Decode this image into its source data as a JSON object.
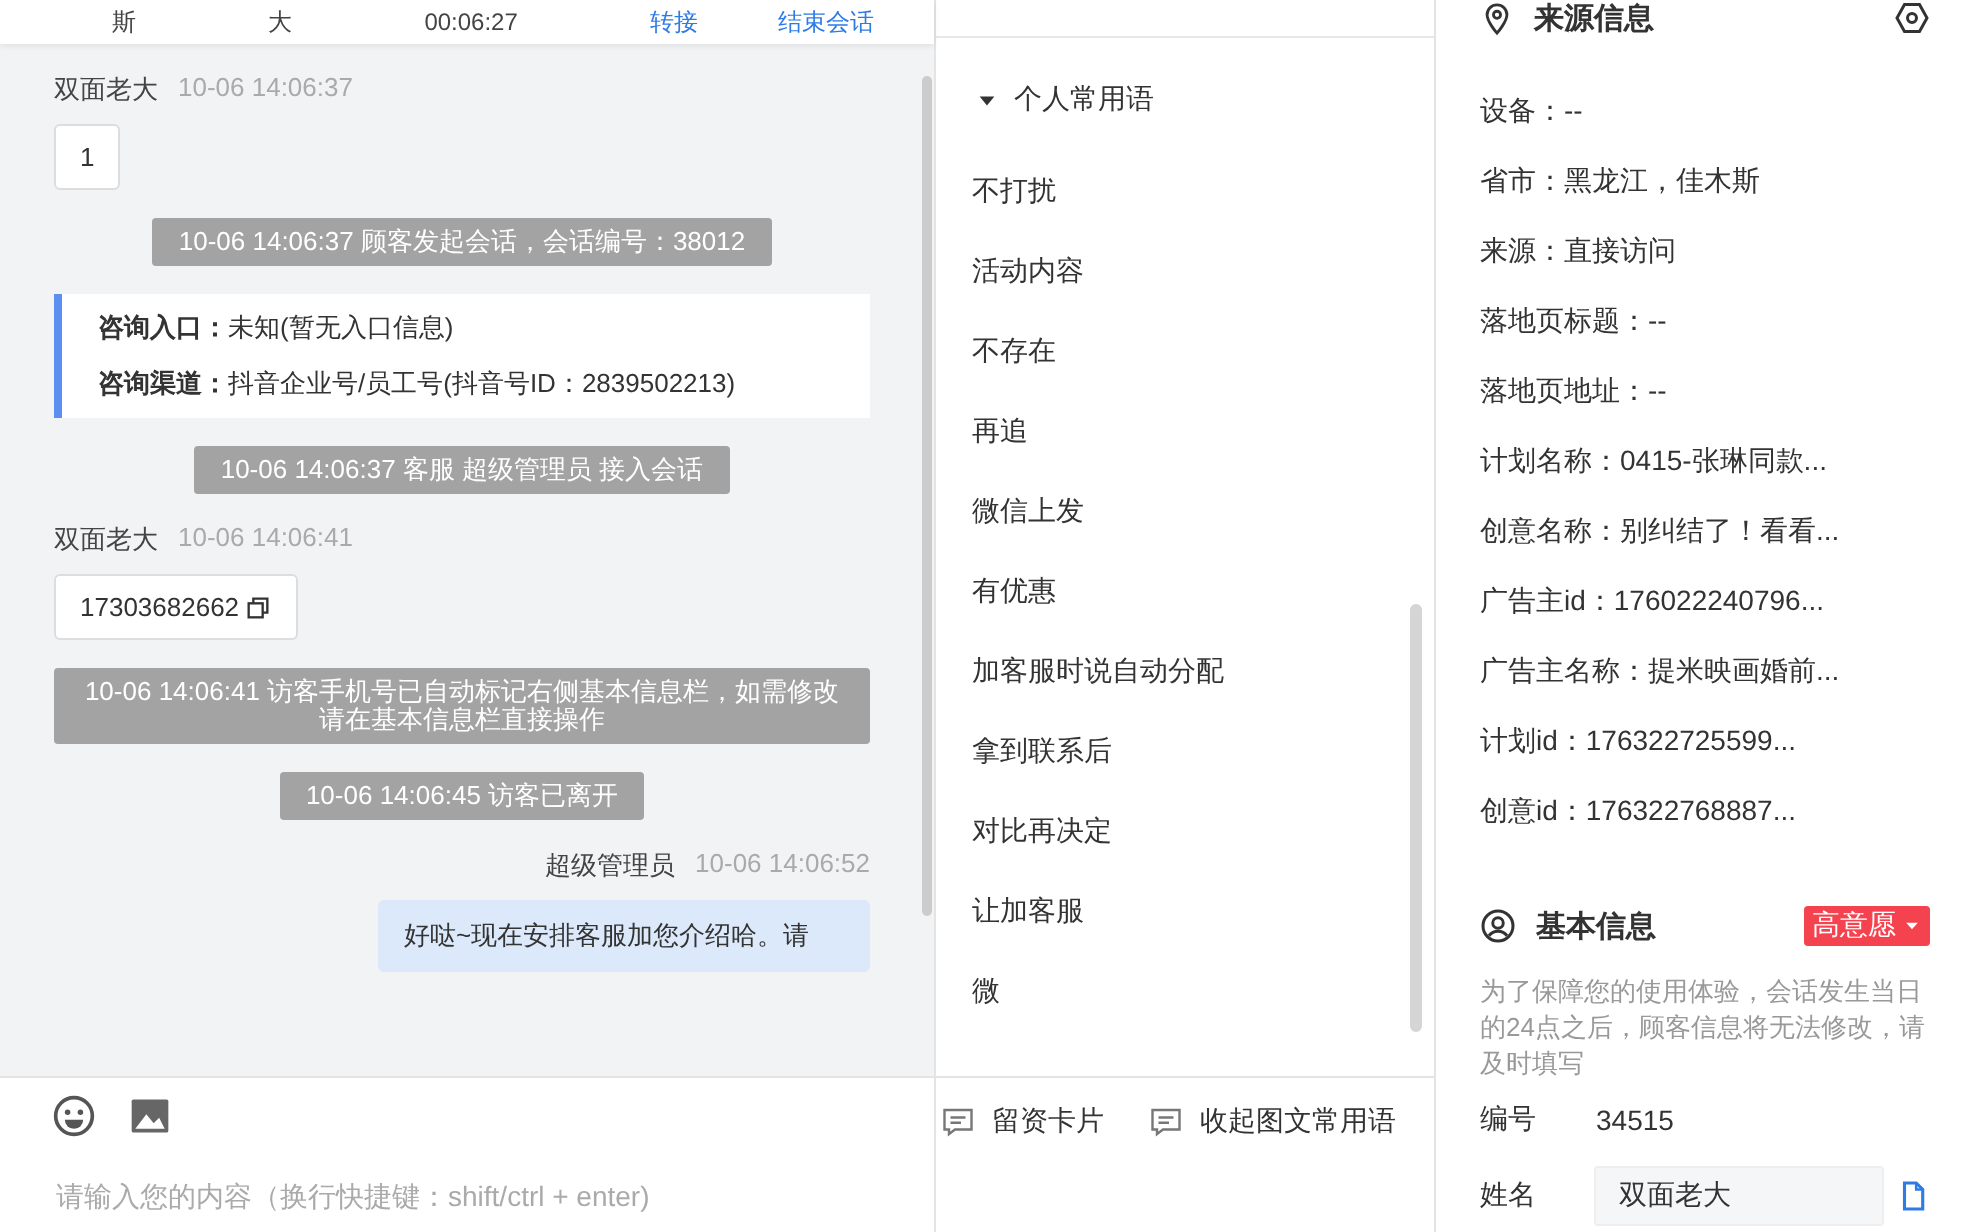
{
  "header": {
    "cells": [
      "斯",
      "大",
      "00:06:27"
    ],
    "links": [
      "转接",
      "结束会话"
    ]
  },
  "chat": {
    "messages": [
      {
        "kind": "visitor",
        "sender": "双面老大",
        "time": "10-06 14:06:37",
        "text": "1",
        "copyable": false
      },
      {
        "kind": "system",
        "text": "10-06 14:06:37 顾客发起会话，会话编号：38012"
      },
      {
        "kind": "info",
        "lines": [
          {
            "label": "咨询入口：",
            "value": "未知(暂无入口信息)"
          },
          {
            "label": "咨询渠道：",
            "value": "抖音企业号/员工号(抖音号ID：2839502213)"
          }
        ]
      },
      {
        "kind": "system",
        "text": "10-06 14:06:37 客服 超级管理员 接入会话"
      },
      {
        "kind": "visitor",
        "sender": "双面老大",
        "time": "10-06 14:06:41",
        "text": "17303682662",
        "copyable": true
      },
      {
        "kind": "system",
        "text": "10-06 14:06:41 访客手机号已自动标记右侧基本信息栏，如需修改请在基本信息栏直接操作"
      },
      {
        "kind": "system",
        "text": "10-06 14:06:45 访客已离开"
      },
      {
        "kind": "agent",
        "sender": "超级管理员",
        "time": "10-06 14:06:52",
        "text": "好哒~现在安排客服加您介绍哈。请"
      }
    ]
  },
  "composer": {
    "placeholder": "请输入您的内容（换行快捷键：shift/ctrl + enter)"
  },
  "phrases": {
    "title": "个人常用语",
    "expanded": true,
    "items": [
      "不打扰",
      "活动内容",
      "不存在",
      "再追",
      "微信上发",
      "有优惠",
      "加客服时说自动分配",
      "拿到联系后",
      "对比再决定",
      "让加客服",
      "微"
    ]
  },
  "phrase_toolbar": [
    "留资卡片",
    "收起图文常用语"
  ],
  "source_info": {
    "title": "来源信息",
    "fields": [
      "设备：--",
      "省市：黑龙江，佳木斯",
      "来源：直接访问",
      "落地页标题：--",
      "落地页地址：--",
      "计划名称：0415-张琳同款...",
      "创意名称：别纠结了！看看...",
      "广告主id：176022240796...",
      "广告主名称：提米映画婚前...",
      "计划id：176322725599...",
      "创意id：176322768887..."
    ]
  },
  "basic_info": {
    "title": "基本信息",
    "tag": "高意愿",
    "note": "为了保障您的使用体验，会话发生当日的24点之后，顾客信息将无法修改，请及时填写",
    "fields": [
      {
        "kind": "text",
        "label": "编号",
        "value": "34515"
      },
      {
        "kind": "input",
        "label": "姓名",
        "value": "双面老大"
      }
    ]
  }
}
